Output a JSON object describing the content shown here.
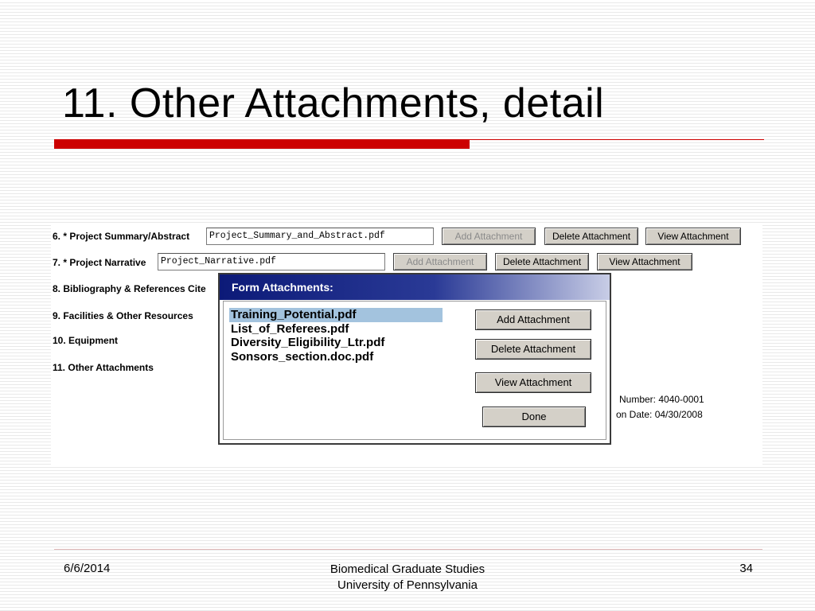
{
  "slide": {
    "title": "11. Other Attachments, detail",
    "accent_color": "#cc0000"
  },
  "form": {
    "rows": [
      {
        "label": "6. * Project Summary/Abstract",
        "file": "Project_Summary_and_Abstract.pdf"
      },
      {
        "label": "7. * Project Narrative",
        "file": "Project_Narrative.pdf"
      },
      {
        "label": "8. Bibliography & References Cite"
      },
      {
        "label": "9. Facilities & Other Resources"
      },
      {
        "label": "10. Equipment"
      },
      {
        "label": "11. Other Attachments"
      }
    ],
    "buttons": {
      "add": "Add Attachment",
      "delete": "Delete Attachment",
      "view": "View Attachment"
    },
    "info": {
      "number": "Number: 4040-0001",
      "date": "on Date: 04/30/2008"
    }
  },
  "dialog": {
    "title": "Form Attachments:",
    "titlebar_color": "#0c1a78",
    "files": [
      "Training_Potential.pdf",
      "List_of_Referees.pdf",
      "Diversity_Eligibility_Ltr.pdf",
      "Sonsors_section.doc.pdf"
    ],
    "selected_index": 0,
    "buttons": {
      "add": "Add Attachment",
      "delete": "Delete Attachment",
      "view": "View Attachment",
      "done": "Done"
    }
  },
  "footer": {
    "date": "6/6/2014",
    "center_line1": "Biomedical Graduate Studies",
    "center_line2": "University of Pennsylvania",
    "page": "34"
  }
}
